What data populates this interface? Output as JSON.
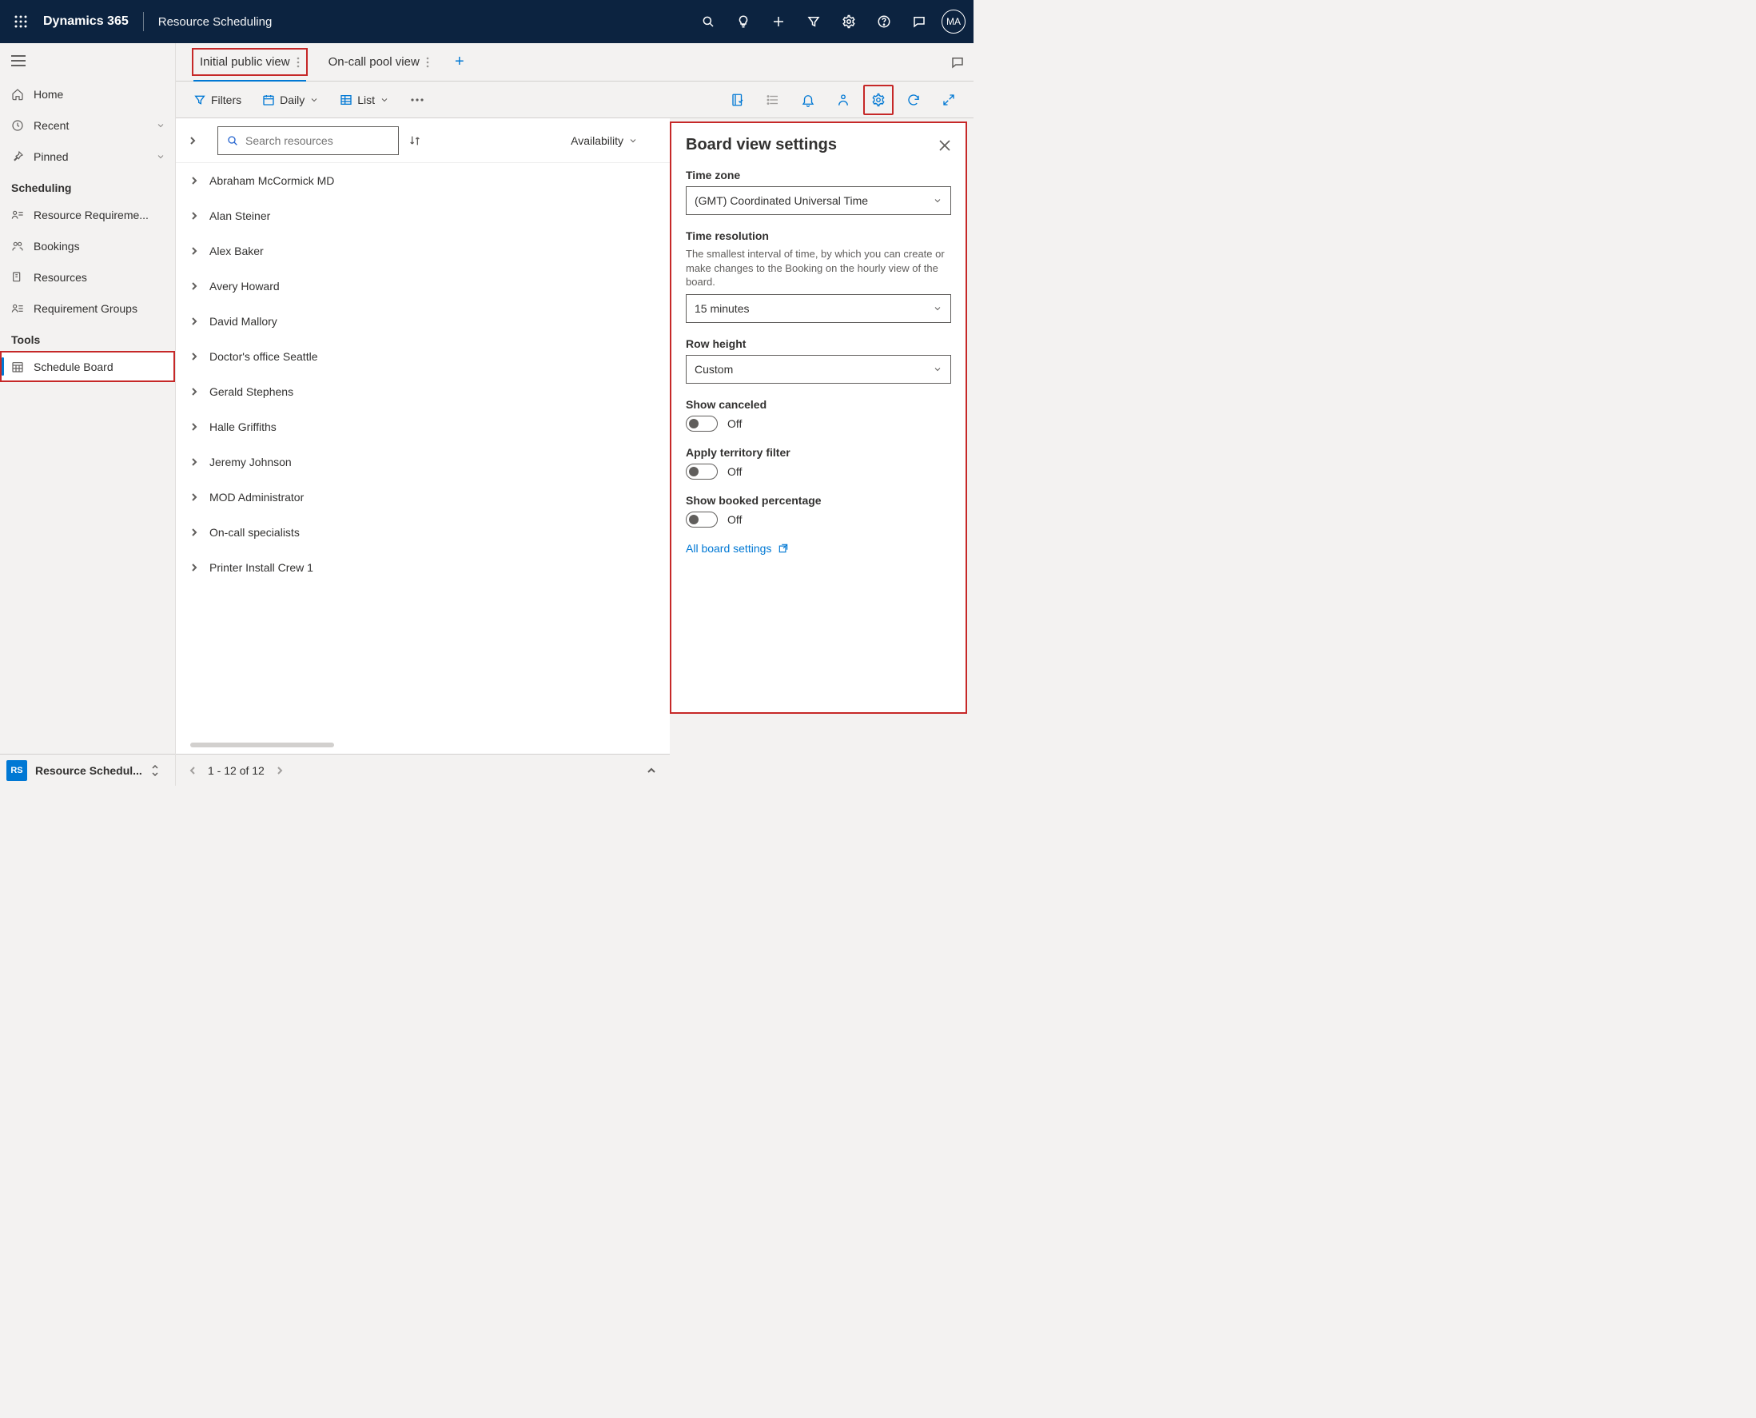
{
  "topbar": {
    "brand": "Dynamics 365",
    "product": "Resource Scheduling",
    "avatar_initials": "MA"
  },
  "sidebar": {
    "home": "Home",
    "recent": "Recent",
    "pinned": "Pinned",
    "section_scheduling": "Scheduling",
    "item_resource_req": "Resource Requireme...",
    "item_bookings": "Bookings",
    "item_resources": "Resources",
    "item_req_groups": "Requirement Groups",
    "section_tools": "Tools",
    "item_schedule_board": "Schedule Board"
  },
  "tabs": {
    "initial_public": "Initial public view",
    "on_call": "On-call pool view"
  },
  "toolbar": {
    "filters": "Filters",
    "daily": "Daily",
    "list": "List"
  },
  "resources": {
    "search_placeholder": "Search resources",
    "availability": "Availability",
    "rows": [
      "Abraham McCormick MD",
      "Alan Steiner",
      "Alex Baker",
      "Avery Howard",
      "David Mallory",
      "Doctor's office Seattle",
      "Gerald Stephens",
      "Halle Griffiths",
      "Jeremy Johnson",
      "MOD Administrator",
      "On-call specialists",
      "Printer Install Crew 1"
    ]
  },
  "panel": {
    "title": "Board view settings",
    "timezone_label": "Time zone",
    "timezone_value": "(GMT) Coordinated Universal Time",
    "timeres_label": "Time resolution",
    "timeres_help": "The smallest interval of time, by which you can create or make changes to the Booking on the hourly view of the board.",
    "timeres_value": "15 minutes",
    "rowheight_label": "Row height",
    "rowheight_value": "Custom",
    "show_canceled_label": "Show canceled",
    "territory_label": "Apply territory filter",
    "booked_pct_label": "Show booked percentage",
    "off": "Off",
    "all_settings": "All board settings"
  },
  "pager": {
    "range": "1 - 12 of 12"
  },
  "bottombar": {
    "app_badge": "RS",
    "app_name": "Resource Schedul..."
  }
}
